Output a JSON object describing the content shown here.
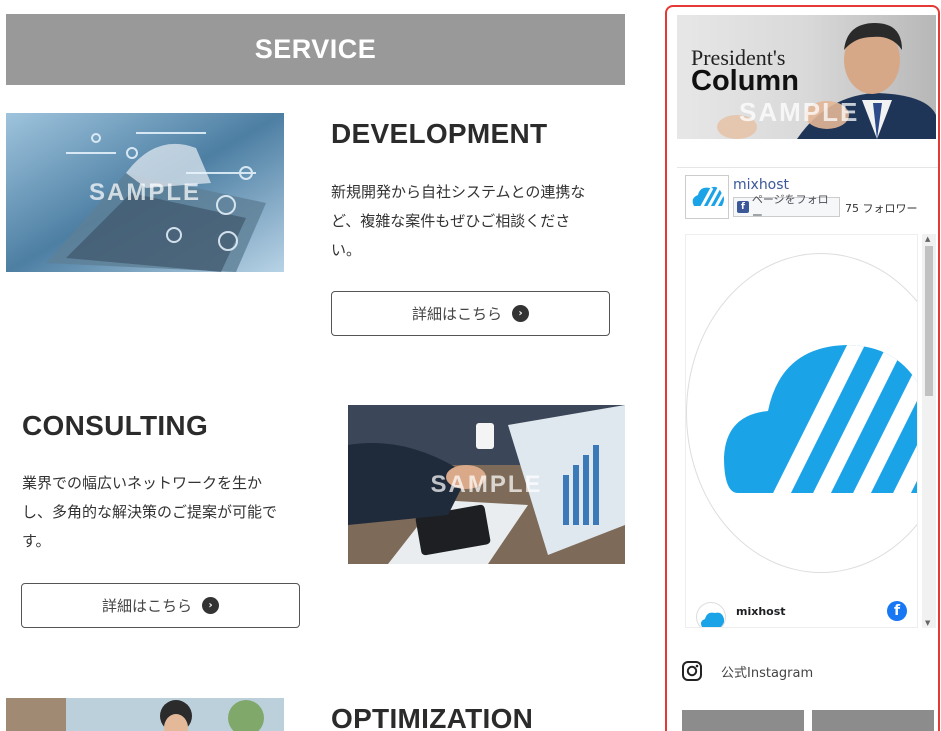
{
  "main": {
    "banner_title": "SERVICE",
    "sections": [
      {
        "title": "DEVELOPMENT",
        "text": [
          "新規開発から自社システムとの連携な",
          "ど、複雑な案件もぜひご相談くださ",
          "い。"
        ],
        "button": "詳細はこちら",
        "watermark": "SAMPLE"
      },
      {
        "title": "CONSULTING",
        "text": [
          "業界での幅広いネットワークを生か",
          "し、多角的な解決策のご提案が可能で",
          "す。"
        ],
        "button": "詳細はこちら",
        "watermark": "SAMPLE"
      },
      {
        "title": "OPTIMIZATION"
      }
    ]
  },
  "sidebar": {
    "column_banner": {
      "line1": "President's",
      "line2": "Column",
      "watermark": "SAMPLE"
    },
    "facebook": {
      "page_name": "mixhost",
      "follow_button": "ページをフォロー",
      "followers": "75 フォロワー",
      "post_author": "mixhost"
    },
    "instagram": {
      "label": "公式Instagram"
    }
  },
  "colors": {
    "banner_gray": "#999999",
    "sidebar_border": "#e53935",
    "brand_blue": "#1ba3e8",
    "facebook_blue": "#1877f2"
  }
}
